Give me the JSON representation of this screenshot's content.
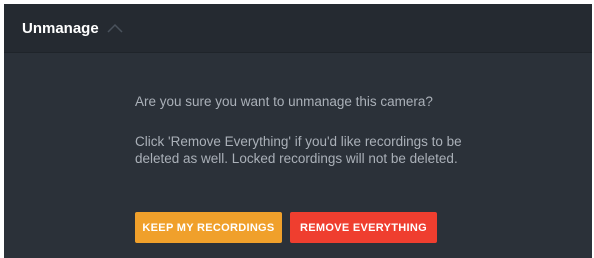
{
  "header": {
    "title": "Unmanage",
    "toggle_icon": "chevron-up-icon"
  },
  "dialog": {
    "question": "Are you sure you want to unmanage this camera?",
    "explanation": "Click 'Remove Everything' if you'd like recordings to be deleted as well. Locked recordings will not be deleted."
  },
  "actions": {
    "keep_label": "KEEP MY RECORDINGS",
    "remove_label": "REMOVE EVERYTHING"
  },
  "colors": {
    "panel_background": "#2b3139",
    "header_background": "#252a31",
    "keep_button": "#f0a02b",
    "remove_button": "#ef3e2f",
    "body_text": "#aab0b8"
  }
}
